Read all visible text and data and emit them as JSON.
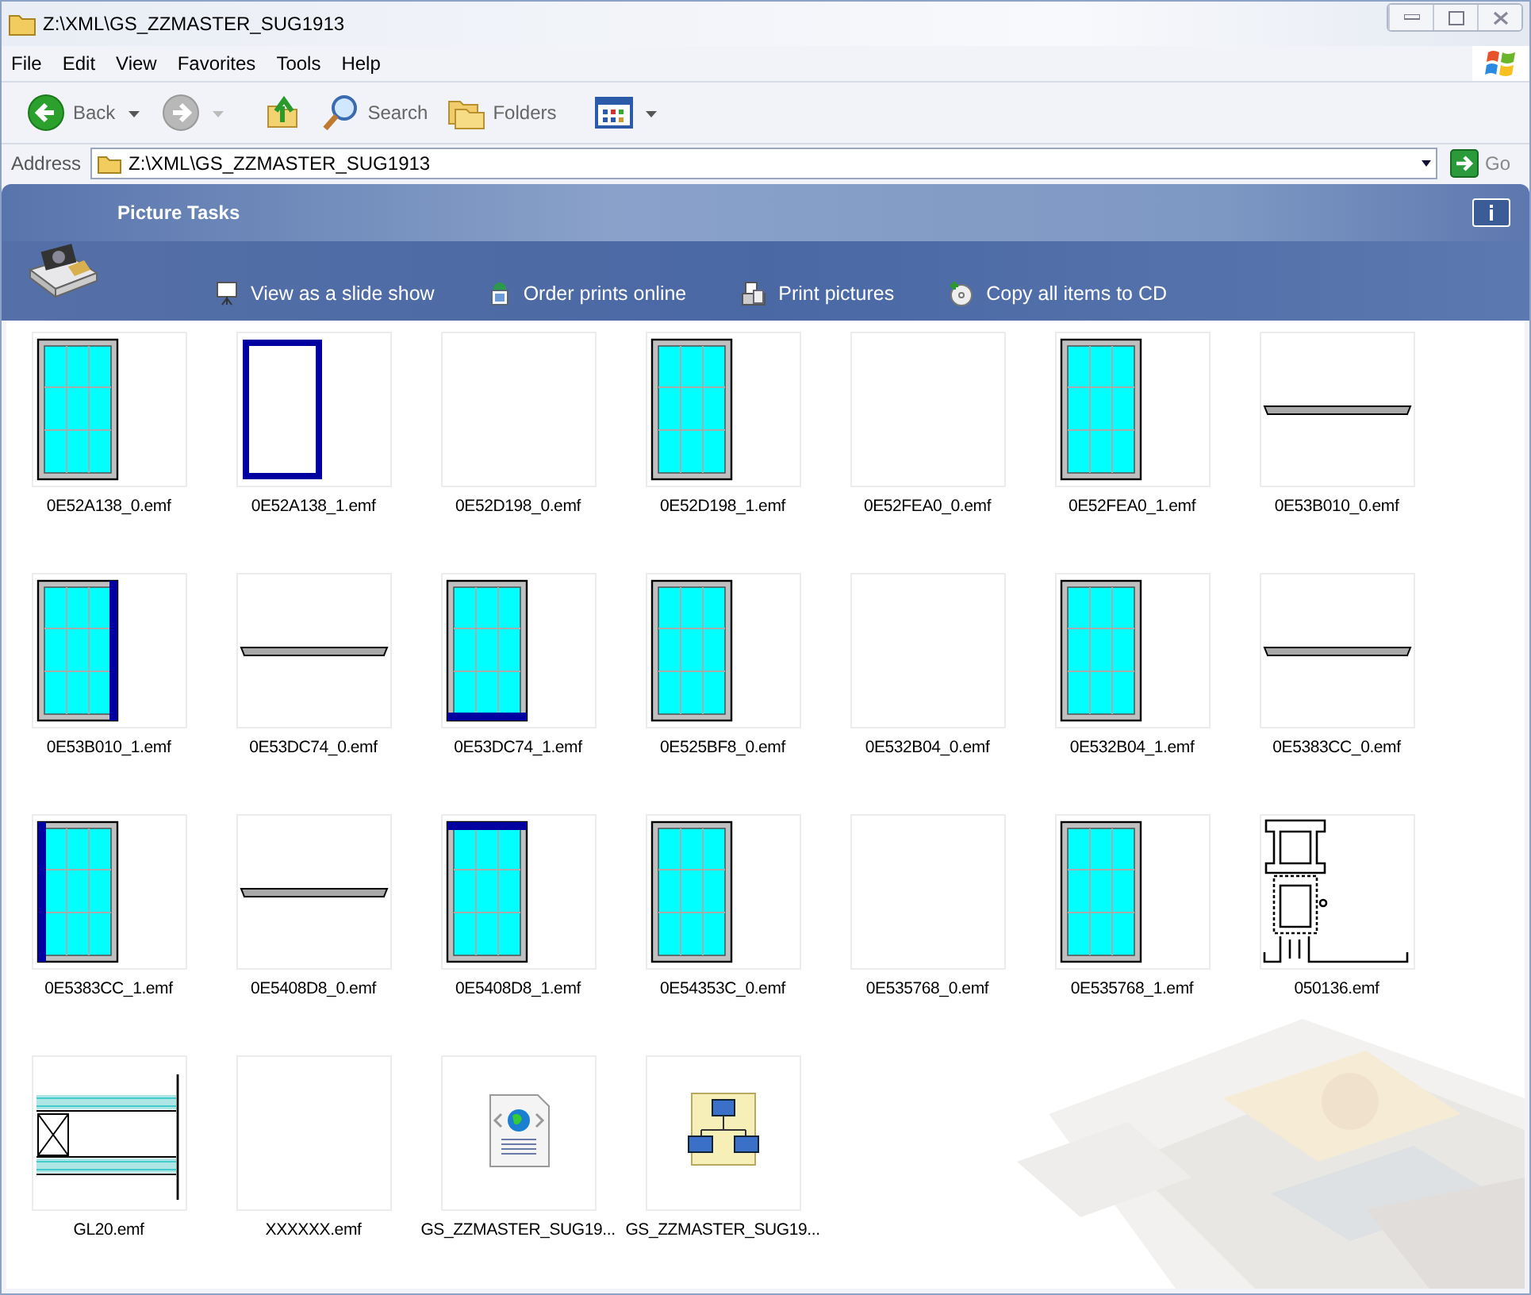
{
  "window": {
    "title": "Z:\\XML\\GS_ZZMASTER_SUG1913"
  },
  "menu": [
    "File",
    "Edit",
    "View",
    "Favorites",
    "Tools",
    "Help"
  ],
  "toolbar": [
    {
      "kind": "back",
      "label": "Back",
      "disabled": false
    },
    {
      "kind": "forward",
      "disabled": true
    },
    {
      "kind": "up"
    },
    {
      "kind": "search",
      "label": "Search"
    },
    {
      "kind": "folders",
      "label": "Folders"
    },
    {
      "kind": "views"
    }
  ],
  "address": {
    "label": "Address",
    "value": "Z:\\XML\\GS_ZZMASTER_SUG1913",
    "go": "Go"
  },
  "tasks": {
    "title": "Picture Tasks",
    "items": [
      {
        "kind": "slideshow",
        "label": "View as a slide show"
      },
      {
        "kind": "order",
        "label": "Order prints online"
      },
      {
        "kind": "print",
        "label": "Print pictures"
      },
      {
        "kind": "cd",
        "label": "Copy all items to CD"
      }
    ]
  },
  "files": [
    {
      "name": "0E52A138_0.emf",
      "kind": "window"
    },
    {
      "name": "0E52A138_1.emf",
      "kind": "outline"
    },
    {
      "name": "0E52D198_0.emf",
      "kind": "blank"
    },
    {
      "name": "0E52D198_1.emf",
      "kind": "window"
    },
    {
      "name": "0E52FEA0_0.emf",
      "kind": "blank"
    },
    {
      "name": "0E52FEA0_1.emf",
      "kind": "window"
    },
    {
      "name": "0E53B010_0.emf",
      "kind": "bar"
    },
    {
      "name": "0E53B010_1.emf",
      "kind": "window-right"
    },
    {
      "name": "0E53DC74_0.emf",
      "kind": "bar"
    },
    {
      "name": "0E53DC74_1.emf",
      "kind": "window-bottom"
    },
    {
      "name": "0E525BF8_0.emf",
      "kind": "window"
    },
    {
      "name": "0E532B04_0.emf",
      "kind": "blank"
    },
    {
      "name": "0E532B04_1.emf",
      "kind": "window"
    },
    {
      "name": "0E5383CC_0.emf",
      "kind": "bar"
    },
    {
      "name": "0E5383CC_1.emf",
      "kind": "window-left"
    },
    {
      "name": "0E5408D8_0.emf",
      "kind": "bar"
    },
    {
      "name": "0E5408D8_1.emf",
      "kind": "window-top"
    },
    {
      "name": "0E54353C_0.emf",
      "kind": "window"
    },
    {
      "name": "0E535768_0.emf",
      "kind": "blank"
    },
    {
      "name": "0E535768_1.emf",
      "kind": "window"
    },
    {
      "name": "050136.emf",
      "kind": "profile"
    },
    {
      "name": "GL20.emf",
      "kind": "glass"
    },
    {
      "name": "XXXXXX.emf",
      "kind": "blank"
    },
    {
      "name": "GS_ZZMASTER_SUG19...",
      "kind": "xml"
    },
    {
      "name": "GS_ZZMASTER_SUG19...",
      "kind": "schema"
    }
  ]
}
